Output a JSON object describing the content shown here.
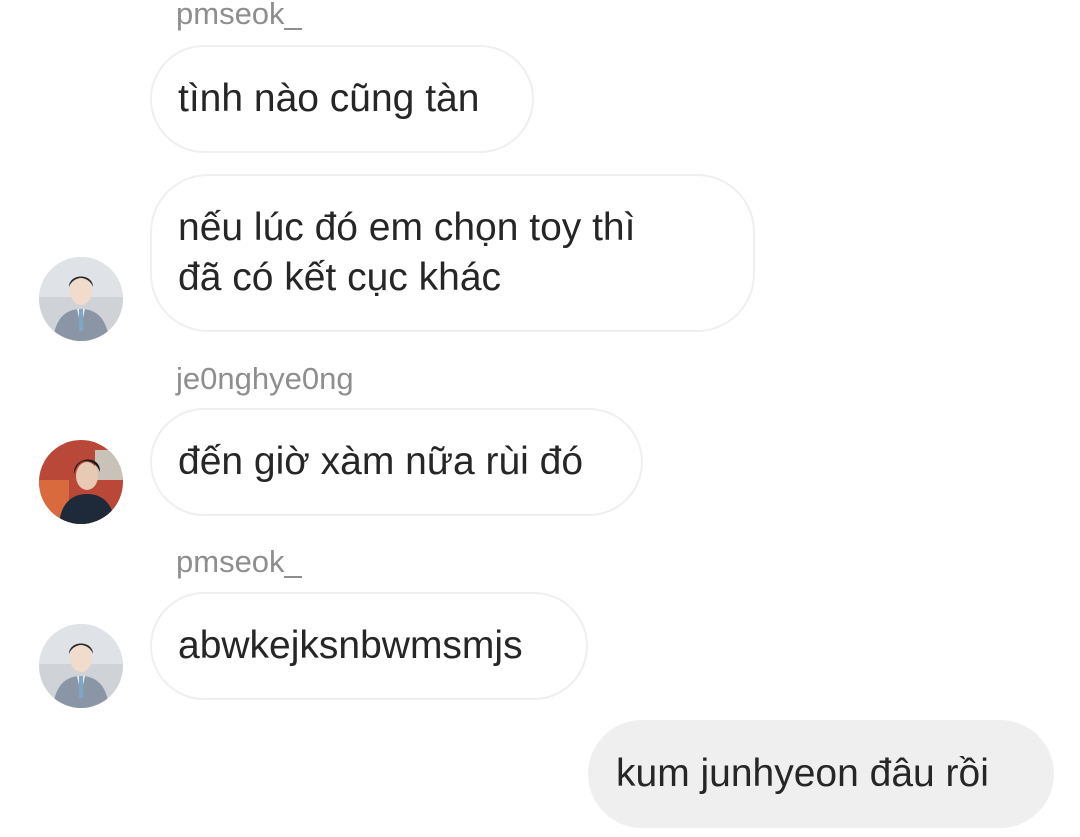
{
  "thread": {
    "messages": [
      {
        "username": "pmseok_",
        "text": "tình nào cũng tàn"
      },
      {
        "username": "",
        "text": "nếu lúc đó em chọn toy thì\nđã có kết cục khác"
      },
      {
        "username": "je0nghye0ng",
        "text": "đến giờ xàm nữa rùi đó"
      },
      {
        "username": "pmseok_",
        "text": "abwkejksnbwmsmjs"
      },
      {
        "username": "",
        "text": "kum junhyeon đâu rồi"
      }
    ]
  },
  "avatars": {
    "pmseok_": {
      "icon": "user-avatar-photo",
      "bg": "#cfd3d8",
      "suit": "#8a96a6",
      "face": "#f1dccb",
      "hair": "#2a2a2a"
    },
    "je0nghye0ng": {
      "icon": "user-avatar-photo",
      "bg": "#b94838",
      "suit": "#1e2a3a",
      "face": "#e8c9b4",
      "hair": "#1a1a1a"
    }
  },
  "colors": {
    "incoming_bubble_border": "#efefef",
    "outgoing_bubble_bg": "#efefef",
    "username_text": "#8e8e8e",
    "message_text": "#262626"
  }
}
